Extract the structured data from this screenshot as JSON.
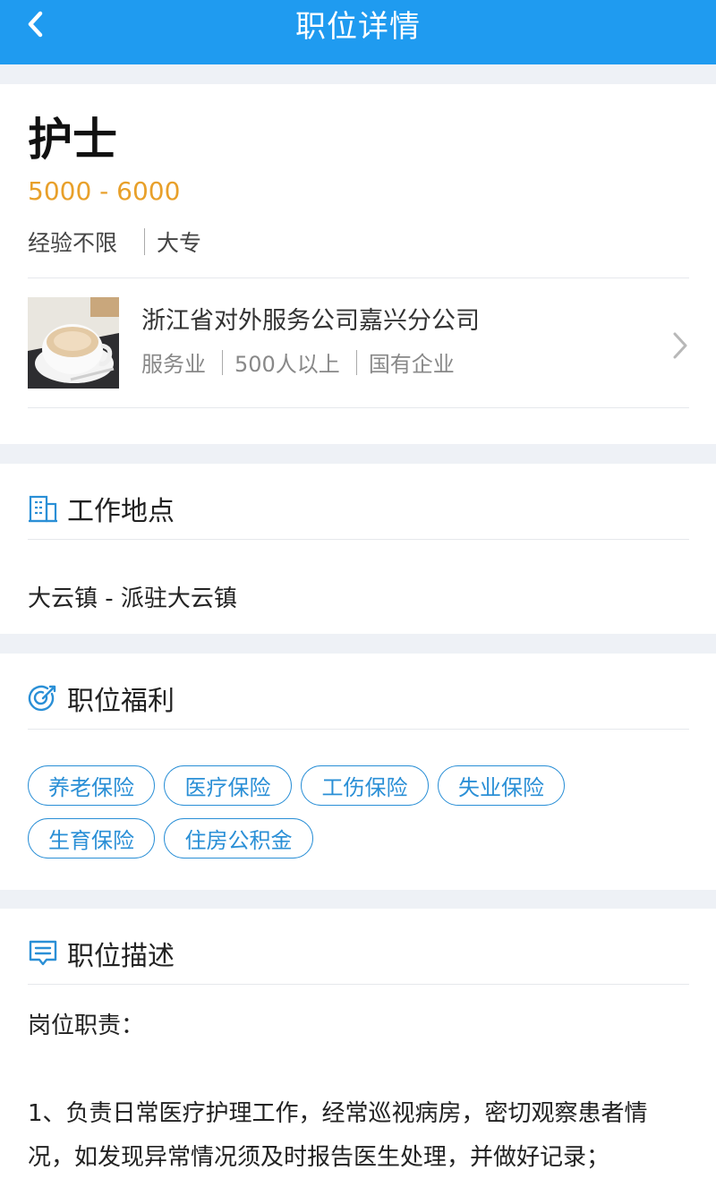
{
  "header": {
    "title": "职位详情"
  },
  "job": {
    "title": "护士",
    "salary": "5000 - 6000",
    "experience": "经验不限",
    "education": "大专"
  },
  "company": {
    "name": "浙江省对外服务公司嘉兴分公司",
    "industry": "服务业",
    "size": "500人以上",
    "type": "国有企业"
  },
  "location_section": {
    "title": "工作地点",
    "text": "大云镇 - 派驻大云镇"
  },
  "benefits_section": {
    "title": "职位福利",
    "tags": [
      "养老保险",
      "医疗保险",
      "工伤保险",
      "失业保险",
      "生育保险",
      "住房公积金"
    ]
  },
  "description_section": {
    "title": "职位描述",
    "heading": "岗位职责：",
    "line1": "1、负责日常医疗护理工作，经常巡视病房，密切观察患者情",
    "line2": "况，如发现异常情况须及时报告医生处理，并做好记录；"
  },
  "colors": {
    "primary": "#1f9bf0",
    "salary": "#e8a02a",
    "tag": "#2a8fd6",
    "background": "#eef1f6"
  }
}
